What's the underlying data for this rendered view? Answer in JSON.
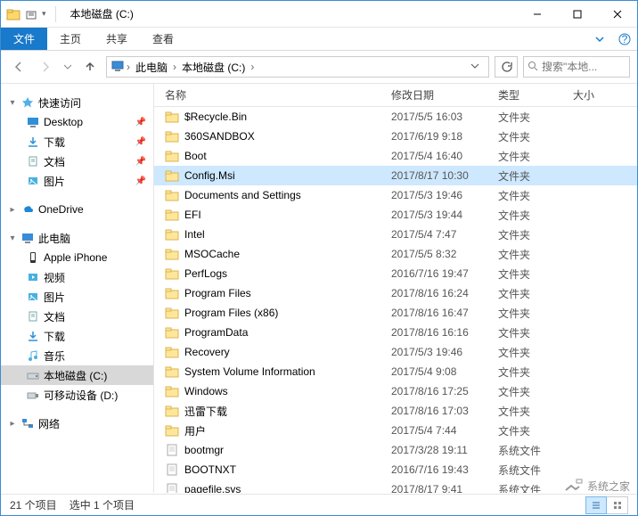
{
  "window": {
    "title": "本地磁盘 (C:)",
    "min": "—",
    "max": "☐",
    "close": "✕"
  },
  "ribbon": {
    "file": "文件",
    "home": "主页",
    "share": "共享",
    "view": "查看"
  },
  "address": {
    "root_icon": "pc-icon",
    "crumbs": [
      "此电脑",
      "本地磁盘 (C:)"
    ],
    "search_placeholder": "搜索\"本地..."
  },
  "nav": {
    "quick_access": "快速访问",
    "quick_items": [
      {
        "label": "Desktop",
        "icon": "desktop",
        "pinned": true
      },
      {
        "label": "下载",
        "icon": "downloads",
        "pinned": true
      },
      {
        "label": "文档",
        "icon": "documents",
        "pinned": true
      },
      {
        "label": "图片",
        "icon": "pictures",
        "pinned": true
      }
    ],
    "onedrive": "OneDrive",
    "this_pc": "此电脑",
    "pc_items": [
      {
        "label": "Apple iPhone",
        "icon": "phone"
      },
      {
        "label": "视频",
        "icon": "videos"
      },
      {
        "label": "图片",
        "icon": "pictures"
      },
      {
        "label": "文档",
        "icon": "documents"
      },
      {
        "label": "下载",
        "icon": "downloads"
      },
      {
        "label": "音乐",
        "icon": "music"
      },
      {
        "label": "本地磁盘 (C:)",
        "icon": "drive",
        "selected": true
      },
      {
        "label": "可移动设备 (D:)",
        "icon": "usb"
      }
    ],
    "network": "网络"
  },
  "columns": {
    "name": "名称",
    "date": "修改日期",
    "type": "类型",
    "size": "大小"
  },
  "files": [
    {
      "name": "$Recycle.Bin",
      "date": "2017/5/5 16:03",
      "type": "文件夹",
      "icon": "folder"
    },
    {
      "name": "360SANDBOX",
      "date": "2017/6/19 9:18",
      "type": "文件夹",
      "icon": "folder"
    },
    {
      "name": "Boot",
      "date": "2017/5/4 16:40",
      "type": "文件夹",
      "icon": "folder"
    },
    {
      "name": "Config.Msi",
      "date": "2017/8/17 10:30",
      "type": "文件夹",
      "icon": "folder",
      "selected": true
    },
    {
      "name": "Documents and Settings",
      "date": "2017/5/3 19:46",
      "type": "文件夹",
      "icon": "folder"
    },
    {
      "name": "EFI",
      "date": "2017/5/3 19:44",
      "type": "文件夹",
      "icon": "folder"
    },
    {
      "name": "Intel",
      "date": "2017/5/4 7:47",
      "type": "文件夹",
      "icon": "folder"
    },
    {
      "name": "MSOCache",
      "date": "2017/5/5 8:32",
      "type": "文件夹",
      "icon": "folder"
    },
    {
      "name": "PerfLogs",
      "date": "2016/7/16 19:47",
      "type": "文件夹",
      "icon": "folder"
    },
    {
      "name": "Program Files",
      "date": "2017/8/16 16:24",
      "type": "文件夹",
      "icon": "folder"
    },
    {
      "name": "Program Files (x86)",
      "date": "2017/8/16 16:47",
      "type": "文件夹",
      "icon": "folder"
    },
    {
      "name": "ProgramData",
      "date": "2017/8/16 16:16",
      "type": "文件夹",
      "icon": "folder"
    },
    {
      "name": "Recovery",
      "date": "2017/5/3 19:46",
      "type": "文件夹",
      "icon": "folder"
    },
    {
      "name": "System Volume Information",
      "date": "2017/5/4 9:08",
      "type": "文件夹",
      "icon": "folder"
    },
    {
      "name": "Windows",
      "date": "2017/8/16 17:25",
      "type": "文件夹",
      "icon": "folder"
    },
    {
      "name": "迅雷下载",
      "date": "2017/8/16 17:03",
      "type": "文件夹",
      "icon": "folder"
    },
    {
      "name": "用户",
      "date": "2017/5/4 7:44",
      "type": "文件夹",
      "icon": "folder"
    },
    {
      "name": "bootmgr",
      "date": "2017/3/28 19:11",
      "type": "系统文件",
      "icon": "file"
    },
    {
      "name": "BOOTNXT",
      "date": "2016/7/16 19:43",
      "type": "系统文件",
      "icon": "file"
    },
    {
      "name": "pagefile.sys",
      "date": "2017/8/17 9:41",
      "type": "系统文件",
      "icon": "file"
    }
  ],
  "status": {
    "count": "21 个项目",
    "selected": "选中 1 个项目"
  },
  "watermark": "系统之家"
}
